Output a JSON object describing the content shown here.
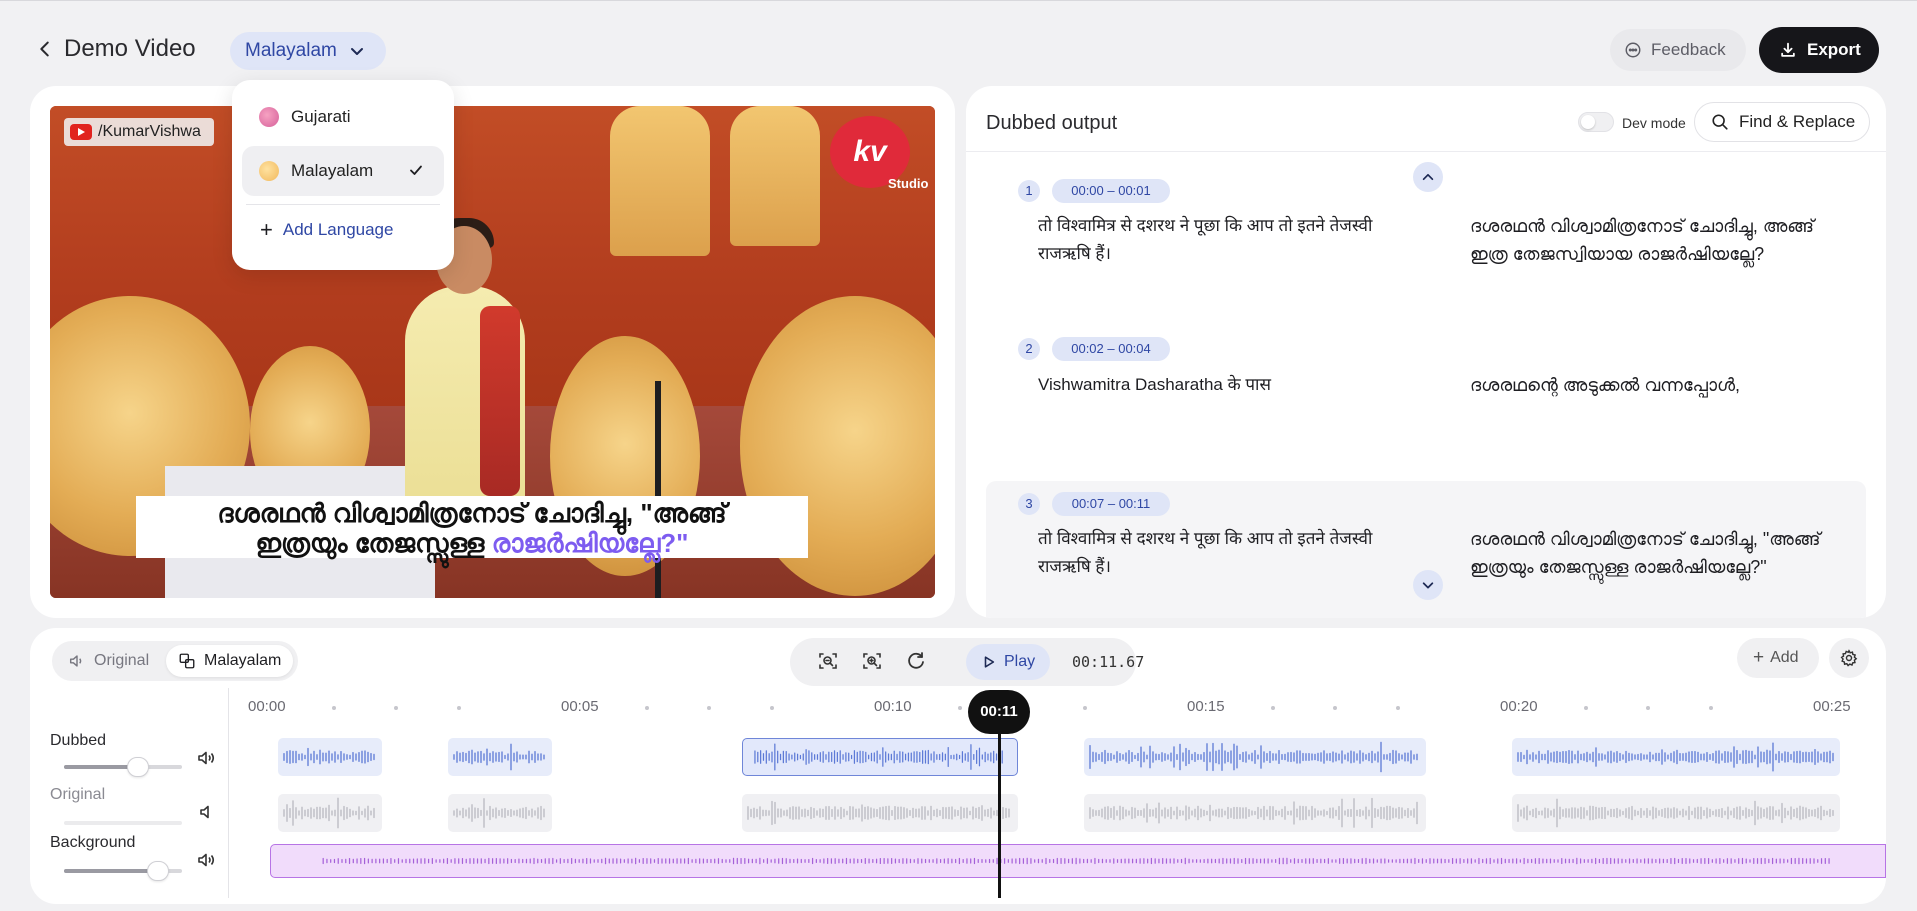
{
  "header": {
    "title": "Demo Video",
    "language_selected": "Malayalam",
    "feedback_label": "Feedback",
    "export_label": "Export"
  },
  "language_menu": {
    "items": [
      {
        "label": "Gujarati",
        "selected": false
      },
      {
        "label": "Malayalam",
        "selected": true
      }
    ],
    "add_label": "Add Language"
  },
  "video": {
    "channel": "/KumarVishwa",
    "logo_text": "kv",
    "logo_sub": "Studio",
    "subtitle_line1": "ദശരഥൻ വിശ്വാമിത്രനോട് ചോദിച്ചു, \"അങ്ങ്",
    "subtitle_line2_plain": "ഇത്രയും തേജസ്സുള്ള ",
    "subtitle_line2_highlight": "രാജർഷിയല്ലേ?\""
  },
  "dubbed_output": {
    "title": "Dubbed output",
    "dev_mode_label": "Dev mode",
    "find_replace_label": "Find & Replace",
    "segments": [
      {
        "num": "1",
        "time": "00:00 – 00:01",
        "source": "तो विश्वामित्र से दशरथ ने पूछा कि आप तो इतने तेजस्वी राजऋषि हैं।",
        "dubbed": "ദശരഥൻ വിശ്വാമിത്രനോട് ചോദിച്ചു, അങ്ങ് ഇത്ര തേജസ്വിയായ രാജർഷിയല്ലേ?"
      },
      {
        "num": "2",
        "time": "00:02 – 00:04",
        "source": "Vishwamitra Dasharatha के पास",
        "dubbed": "ദശരഥന്റെ അടുക്കൽ വന്നപ്പോൾ,"
      },
      {
        "num": "3",
        "time": "00:07 – 00:11",
        "source": "तो विश्वामित्र से दशरथ ने पूछा कि आप तो इतने तेजस्वी राजऋषि हैं।",
        "dubbed": "ദശരഥൻ വിശ്വാമിത്രനോട് ചോദിച്ചു, \"അങ്ങ് ഇത്രയും തേജസ്സുള്ള രാജർഷിയല്ലേ?\""
      }
    ]
  },
  "timeline": {
    "mode_original": "Original",
    "mode_dubbed": "Malayalam",
    "play_label": "Play",
    "timecode": "00:11.67",
    "add_label": "Add",
    "playhead_label": "00:11",
    "ruler_labels": [
      "00:00",
      "00:05",
      "00:10",
      "00:15",
      "00:20",
      "00:25"
    ],
    "tracks": [
      {
        "label": "Dubbed",
        "volume": 0.63
      },
      {
        "label": "Original",
        "volume": 0.0
      },
      {
        "label": "Background",
        "volume": 0.8
      }
    ]
  },
  "colors": {
    "accent": "#2f47a4",
    "accent_bg": "#dfe5f7",
    "export_bg": "#16161a",
    "background_clip": "#b774e5",
    "subtitle_highlight": "#7d5cf0"
  }
}
